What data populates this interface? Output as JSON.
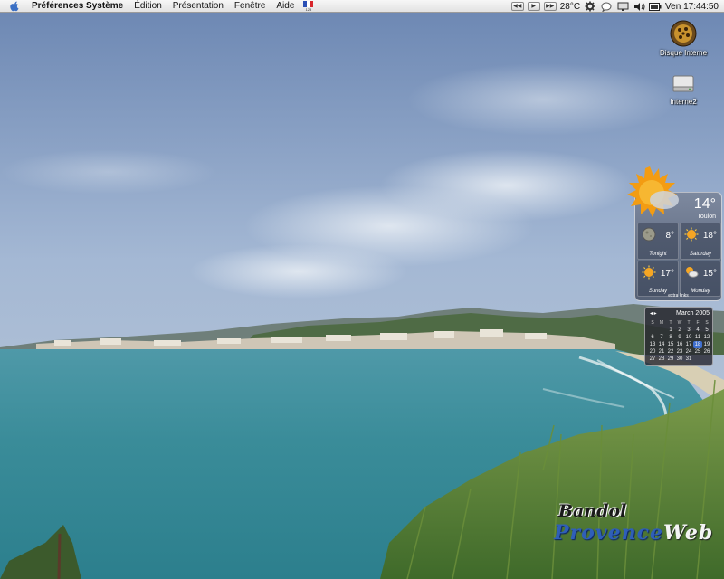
{
  "menubar": {
    "app_name": "Préférences Système",
    "menus": [
      "Édition",
      "Présentation",
      "Fenêtre",
      "Aide"
    ],
    "input_flag_code": "123",
    "temperature": "28°C",
    "clock": "Ven 17:44:50",
    "media_controls": [
      "prev",
      "play",
      "next"
    ],
    "tray_icons": [
      "gear-icon",
      "bubble-icon",
      "display-icon",
      "volume-icon",
      "battery-icon"
    ]
  },
  "desktop": {
    "icons": [
      {
        "label": "Disque Interne",
        "icon": "hard-disk-icon"
      },
      {
        "label": "Interne2",
        "icon": "drive-icon"
      }
    ]
  },
  "weather": {
    "current_temp": "14°",
    "city": "Toulon",
    "forecast": [
      {
        "label": "Tonight",
        "temp": "8°",
        "icon": "moon-icon"
      },
      {
        "label": "Saturday",
        "temp": "18°",
        "icon": "sun-icon"
      },
      {
        "label": "Sunday",
        "temp": "17°",
        "icon": "sun-icon"
      },
      {
        "label": "Monday",
        "temp": "15°",
        "icon": "partly-cloudy-icon"
      }
    ],
    "extra_links": "extra links"
  },
  "calendar": {
    "month": "March 2005",
    "weekdays": [
      "S",
      "M",
      "T",
      "W",
      "T",
      "F",
      "S"
    ],
    "today": "18",
    "weeks": [
      [
        "",
        "",
        "1",
        "2",
        "3",
        "4",
        "5"
      ],
      [
        "6",
        "7",
        "8",
        "9",
        "10",
        "11",
        "12"
      ],
      [
        "13",
        "14",
        "15",
        "16",
        "17",
        "18",
        "19"
      ],
      [
        "20",
        "21",
        "22",
        "23",
        "24",
        "25",
        "26"
      ],
      [
        "27",
        "28",
        "29",
        "30",
        "31",
        "",
        ""
      ]
    ]
  },
  "watermark": {
    "title": "Bandol",
    "brand_a": "Provence",
    "brand_b": "Web"
  },
  "colors": {
    "sea": "#3d8f9c",
    "sky": "#9fb4d0",
    "accent": "#3f6fd0"
  }
}
